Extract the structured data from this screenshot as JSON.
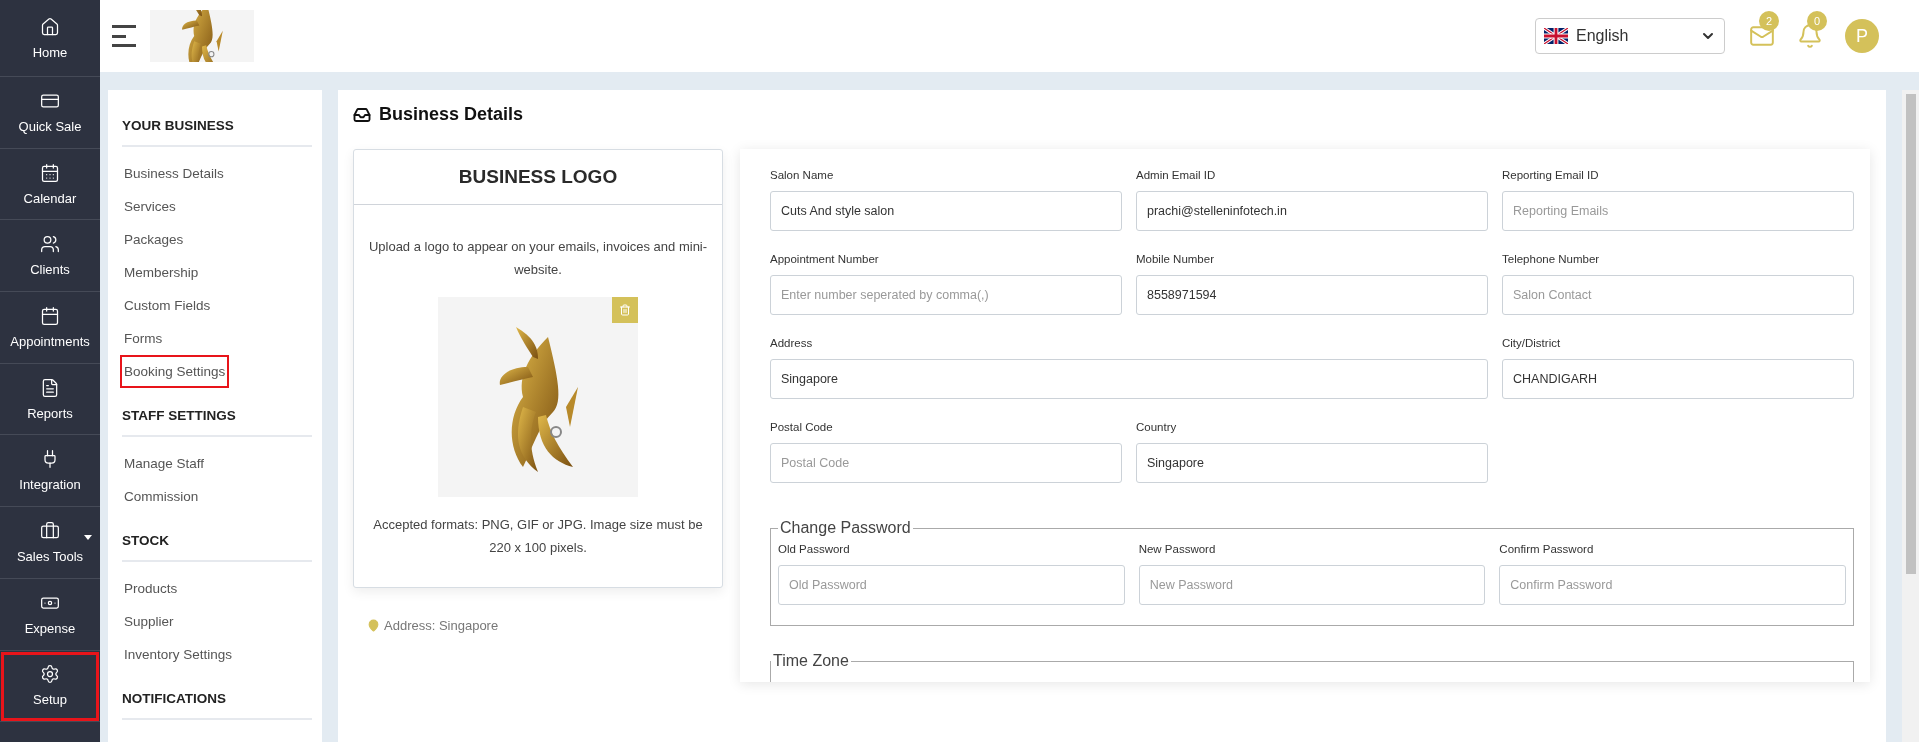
{
  "sidebar": {
    "items": [
      {
        "label": "Home",
        "highlighted": false,
        "dropdown": false
      },
      {
        "label": "Quick Sale",
        "highlighted": false,
        "dropdown": false
      },
      {
        "label": "Calendar",
        "highlighted": false,
        "dropdown": false
      },
      {
        "label": "Clients",
        "highlighted": false,
        "dropdown": false
      },
      {
        "label": "Appointments",
        "highlighted": false,
        "dropdown": false
      },
      {
        "label": "Reports",
        "highlighted": false,
        "dropdown": false
      },
      {
        "label": "Integration",
        "highlighted": false,
        "dropdown": false
      },
      {
        "label": "Sales Tools",
        "highlighted": false,
        "dropdown": true
      },
      {
        "label": "Expense",
        "highlighted": false,
        "dropdown": false
      },
      {
        "label": "Setup",
        "highlighted": true,
        "dropdown": false
      }
    ]
  },
  "topbar": {
    "language": "English",
    "mail_count": "2",
    "notification_count": "0",
    "avatar": "P"
  },
  "settings_nav": {
    "sections": [
      {
        "title": "YOUR BUSINESS",
        "items": [
          {
            "label": "Business Details",
            "highlighted": false
          },
          {
            "label": "Services",
            "highlighted": false
          },
          {
            "label": "Packages",
            "highlighted": false
          },
          {
            "label": "Membership",
            "highlighted": false
          },
          {
            "label": "Custom Fields",
            "highlighted": false
          },
          {
            "label": "Forms",
            "highlighted": false
          },
          {
            "label": "Booking Settings",
            "highlighted": true
          }
        ]
      },
      {
        "title": "STAFF SETTINGS",
        "items": [
          {
            "label": "Manage Staff",
            "highlighted": false
          },
          {
            "label": "Commission",
            "highlighted": false
          }
        ]
      },
      {
        "title": "STOCK",
        "items": [
          {
            "label": "Products",
            "highlighted": false
          },
          {
            "label": "Supplier",
            "highlighted": false
          },
          {
            "label": "Inventory Settings",
            "highlighted": false
          }
        ]
      },
      {
        "title": "NOTIFICATIONS"
      }
    ]
  },
  "page": {
    "title": "Business Details"
  },
  "logo_card": {
    "title": "BUSINESS LOGO",
    "description": "Upload a logo to appear on your emails, invoices and mini-website.",
    "note": "Accepted formats: PNG, GIF or JPG. Image size must be 220 x 100 pixels.",
    "address": "Address: Singapore"
  },
  "form": {
    "fields": [
      {
        "label": "Salon Name",
        "kind": "text",
        "value": "Cuts And style salon"
      },
      {
        "label": "Admin Email ID",
        "kind": "text",
        "value": "prachi@stelleninfotech.in"
      },
      {
        "label": "Reporting Email ID",
        "kind": "text",
        "placeholder": "Reporting Emails"
      },
      {
        "label": "Appointment Number",
        "kind": "text",
        "placeholder": "Enter number seperated by comma(,)"
      },
      {
        "label": "Mobile Number",
        "kind": "text",
        "value": "8558971594"
      },
      {
        "label": "Telephone Number",
        "kind": "text",
        "placeholder": "Salon Contact"
      },
      {
        "label": "Address",
        "kind": "wide",
        "value": "Singapore"
      },
      {
        "label": "City/District",
        "kind": "text",
        "value": "CHANDIGARH"
      },
      {
        "label": "Postal Code",
        "kind": "text",
        "placeholder": "Postal Code"
      },
      {
        "label": "Country",
        "kind": "text",
        "value": "Singapore"
      }
    ]
  },
  "password": {
    "legend": "Change Password",
    "fields": [
      {
        "label": "Old Password",
        "placeholder": "Old Password"
      },
      {
        "label": "New Password",
        "placeholder": "New Password"
      },
      {
        "label": "Confirm Password",
        "placeholder": "Confirm Password"
      }
    ]
  },
  "time_zone": {
    "legend": "Time Zone"
  }
}
